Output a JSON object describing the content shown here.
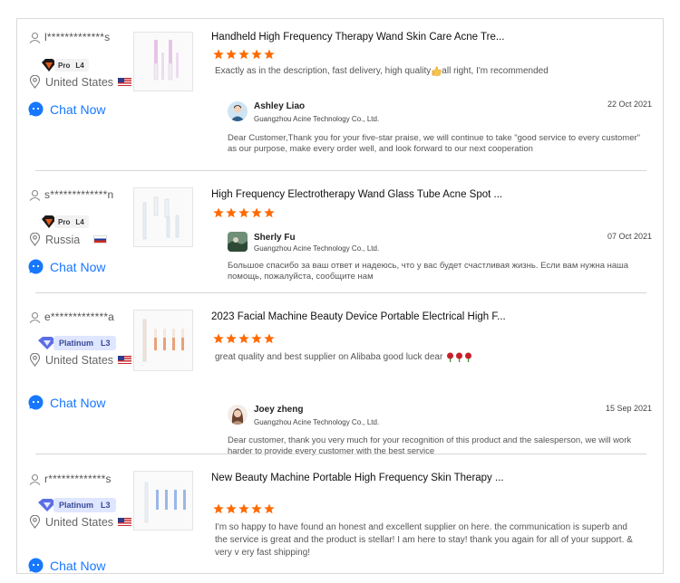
{
  "reviews": [
    {
      "user": "l*************s",
      "tier": {
        "kind": "pro",
        "label": "Pro",
        "level": "L4"
      },
      "country": "United States",
      "flag": "us",
      "chat_label": "Chat Now",
      "product_title": "Handheld High Frequency Therapy Wand Skin Care Acne Tre...",
      "rating": 5,
      "comment": "Exactly as in the description, fast delivery, high quality",
      "comment_tail": "all right, I'm recommended",
      "reply": {
        "name": "Ashley Liao",
        "company": "Guangzhou Acine Technology Co., Ltd.",
        "date": "22 Oct 2021",
        "text": "Dear Customer,Thank you for your five-star praise, we will continue to take \"good service to every customer\" as our purpose, make every order well, and look forward to our next cooperation"
      }
    },
    {
      "user": "s*************n",
      "tier": {
        "kind": "pro",
        "label": "Pro",
        "level": "L4"
      },
      "country": "Russia",
      "flag": "ru",
      "chat_label": "Chat Now",
      "product_title": "High Frequency Electrotherapy Wand Glass Tube Acne Spot ...",
      "rating": 5,
      "comment": "",
      "reply": {
        "name": "Sherly Fu",
        "company": "Guangzhou Acine Technology Co., Ltd.",
        "date": "07 Oct 2021",
        "text": "Большое спасибо за ваш ответ и надеюсь, что у вас будет счастливая жизнь. Если вам нужна наша помощь, пожалуйста, сообщите нам"
      }
    },
    {
      "user": "e*************a",
      "tier": {
        "kind": "platinum",
        "label": "Platinum",
        "level": "L3"
      },
      "country": "United States",
      "flag": "us",
      "chat_label": "Chat Now",
      "product_title": "2023 Facial Machine Beauty Device Portable Electrical High F...",
      "rating": 5,
      "comment": "great quality and best supplier on Alibaba good luck dear",
      "reply": {
        "name": "Joey zheng",
        "company": "Guangzhou Acine Technology Co., Ltd.",
        "date": "15 Sep 2021",
        "text": "Dear customer, thank you very much for your recognition of this product and the salesperson, we will work harder to provide every customer with the best service"
      }
    },
    {
      "user": "r*************s",
      "tier": {
        "kind": "platinum",
        "label": "Platinum",
        "level": "L3"
      },
      "country": "United States",
      "flag": "us",
      "chat_label": "Chat Now",
      "product_title": "New Beauty Machine Portable High Frequency Skin Therapy ...",
      "rating": 5,
      "comment": "I'm so happy to have found an honest and excellent supplier on here. the communication is superb and the service is great and the product is stellar! I am here to stay! thank you again for all of your support. & very v ery fast shipping!"
    }
  ],
  "colors": {
    "accent": "#1677ff",
    "star": "#ff6a00",
    "divider": "#d6d6d6",
    "pro_badge": "#f2f2f2",
    "platinum_badge": "#dfe6ff",
    "platinum_diamond": "#5b6ee6"
  }
}
